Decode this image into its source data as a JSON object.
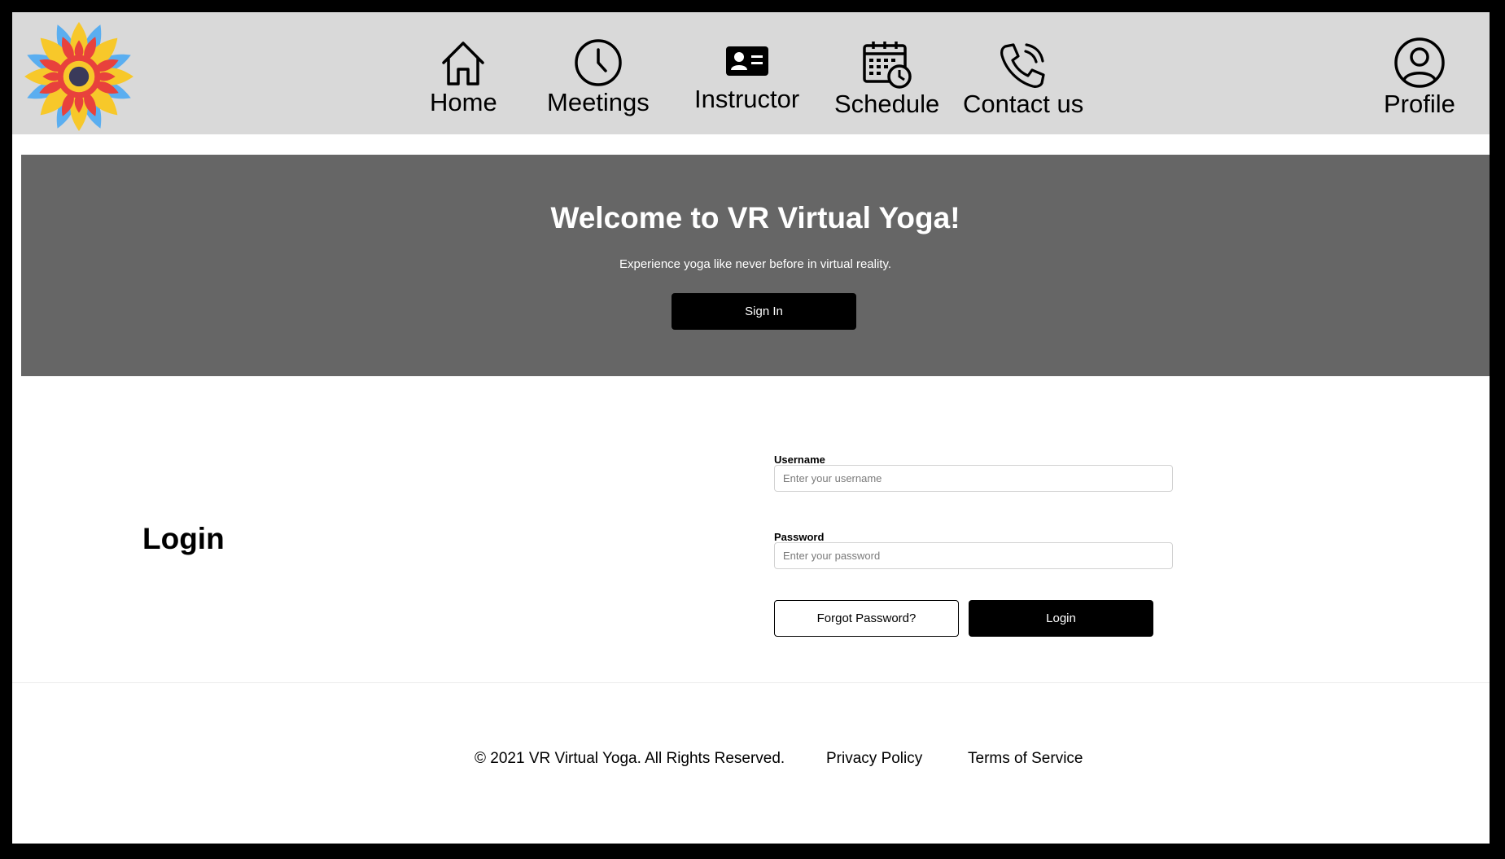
{
  "nav": {
    "logo": "mandala-logo",
    "items": [
      {
        "label": "Home",
        "icon": "home-icon"
      },
      {
        "label": "Meetings",
        "icon": "clock-icon"
      },
      {
        "label": "Instructor",
        "icon": "id-card-icon"
      },
      {
        "label": "Schedule",
        "icon": "calendar-clock-icon"
      },
      {
        "label": "Contact us",
        "icon": "phone-icon"
      }
    ],
    "profile": {
      "label": "Profile",
      "icon": "user-circle-icon"
    }
  },
  "hero": {
    "title": "Welcome to VR Virtual Yoga!",
    "subtitle": "Experience yoga like never before in virtual reality.",
    "signin_label": "Sign In"
  },
  "login": {
    "title": "Login",
    "username_label": "Username",
    "username_placeholder": "Enter your username",
    "password_label": "Password",
    "password_placeholder": "Enter your password",
    "forgot_label": "Forgot Password?",
    "login_label": "Login"
  },
  "footer": {
    "copyright": "© 2021 VR Virtual Yoga. All Rights Reserved.",
    "privacy": "Privacy Policy",
    "terms": "Terms of Service"
  },
  "colors": {
    "nav_bg": "#d9d9d9",
    "hero_bg": "#666666",
    "button_bg": "#000000"
  }
}
